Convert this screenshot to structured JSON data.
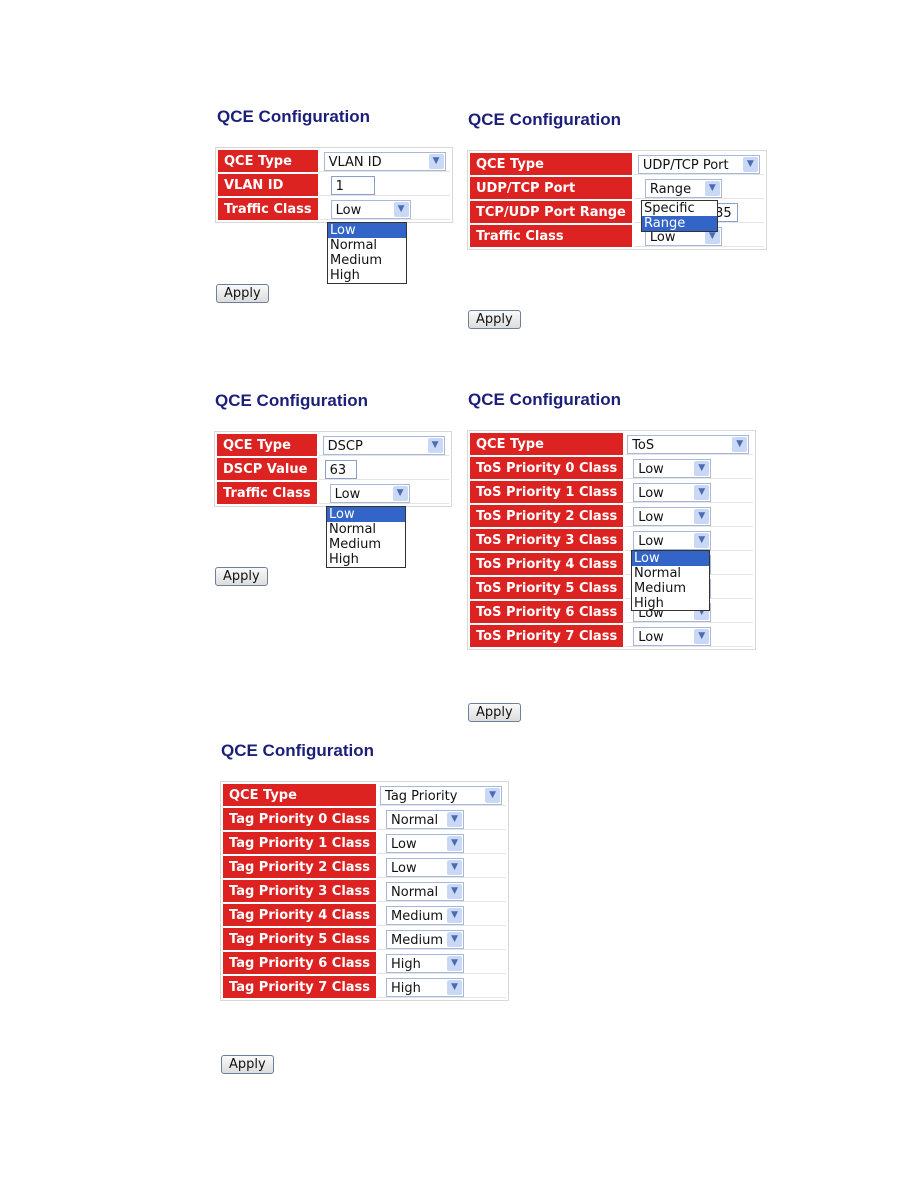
{
  "accent_colors": {
    "label_bg": "#dd2222",
    "title": "#1c1f7a",
    "highlight": "#3365c8"
  },
  "panels": {
    "vlan": {
      "title": "QCE Configuration",
      "rows": [
        {
          "label": "QCE Type",
          "value": "VLAN ID",
          "control": "select"
        },
        {
          "label": "VLAN ID",
          "value": "1",
          "control": "text"
        },
        {
          "label": "Traffic Class",
          "value": "Low",
          "control": "select"
        }
      ],
      "open_list": {
        "options": [
          "Low",
          "Normal",
          "Medium",
          "High"
        ],
        "selected": "Low"
      },
      "apply": "Apply"
    },
    "udptcp": {
      "title": "QCE Configuration",
      "rows": [
        {
          "label": "QCE Type",
          "value": "UDP/TCP Port",
          "control": "select"
        },
        {
          "label": "UDP/TCP Port",
          "value": "Range",
          "control": "select"
        },
        {
          "label": "TCP/UDP Port Range",
          "value": "535",
          "control": "text"
        },
        {
          "label": "Traffic Class",
          "value": "Low",
          "control": "select"
        }
      ],
      "open_list": {
        "options": [
          "Specific",
          "Range"
        ],
        "selected": "Range"
      },
      "apply": "Apply"
    },
    "dscp": {
      "title": "QCE Configuration",
      "rows": [
        {
          "label": "QCE Type",
          "value": "DSCP",
          "control": "select"
        },
        {
          "label": "DSCP Value",
          "value": "63",
          "control": "text"
        },
        {
          "label": "Traffic Class",
          "value": "Low",
          "control": "select"
        }
      ],
      "open_list": {
        "options": [
          "Low",
          "Normal",
          "Medium",
          "High"
        ],
        "selected": "Low"
      },
      "apply": "Apply"
    },
    "tos": {
      "title": "QCE Configuration",
      "rows": [
        {
          "label": "QCE Type",
          "value": "ToS",
          "control": "select"
        },
        {
          "label": "ToS Priority 0 Class",
          "value": "Low",
          "control": "select"
        },
        {
          "label": "ToS Priority 1 Class",
          "value": "Low",
          "control": "select"
        },
        {
          "label": "ToS Priority 2 Class",
          "value": "Low",
          "control": "select"
        },
        {
          "label": "ToS Priority 3 Class",
          "value": "Low",
          "control": "select"
        },
        {
          "label": "ToS Priority 4 Class",
          "value": "Low",
          "control": "select"
        },
        {
          "label": "ToS Priority 5 Class",
          "value": "Low",
          "control": "select"
        },
        {
          "label": "ToS Priority 6 Class",
          "value": "Low",
          "control": "select"
        },
        {
          "label": "ToS Priority 7 Class",
          "value": "Low",
          "control": "select"
        }
      ],
      "open_list": {
        "options": [
          "Low",
          "Normal",
          "Medium",
          "High"
        ],
        "selected": "Low"
      },
      "apply": "Apply"
    },
    "tag": {
      "title": "QCE Configuration",
      "rows": [
        {
          "label": "QCE Type",
          "value": "Tag Priority",
          "control": "select"
        },
        {
          "label": "Tag Priority 0 Class",
          "value": "Normal",
          "control": "select"
        },
        {
          "label": "Tag Priority 1 Class",
          "value": "Low",
          "control": "select"
        },
        {
          "label": "Tag Priority 2 Class",
          "value": "Low",
          "control": "select"
        },
        {
          "label": "Tag Priority 3 Class",
          "value": "Normal",
          "control": "select"
        },
        {
          "label": "Tag Priority 4 Class",
          "value": "Medium",
          "control": "select"
        },
        {
          "label": "Tag Priority 5 Class",
          "value": "Medium",
          "control": "select"
        },
        {
          "label": "Tag Priority 6 Class",
          "value": "High",
          "control": "select"
        },
        {
          "label": "Tag Priority 7 Class",
          "value": "High",
          "control": "select"
        }
      ],
      "apply": "Apply"
    }
  }
}
